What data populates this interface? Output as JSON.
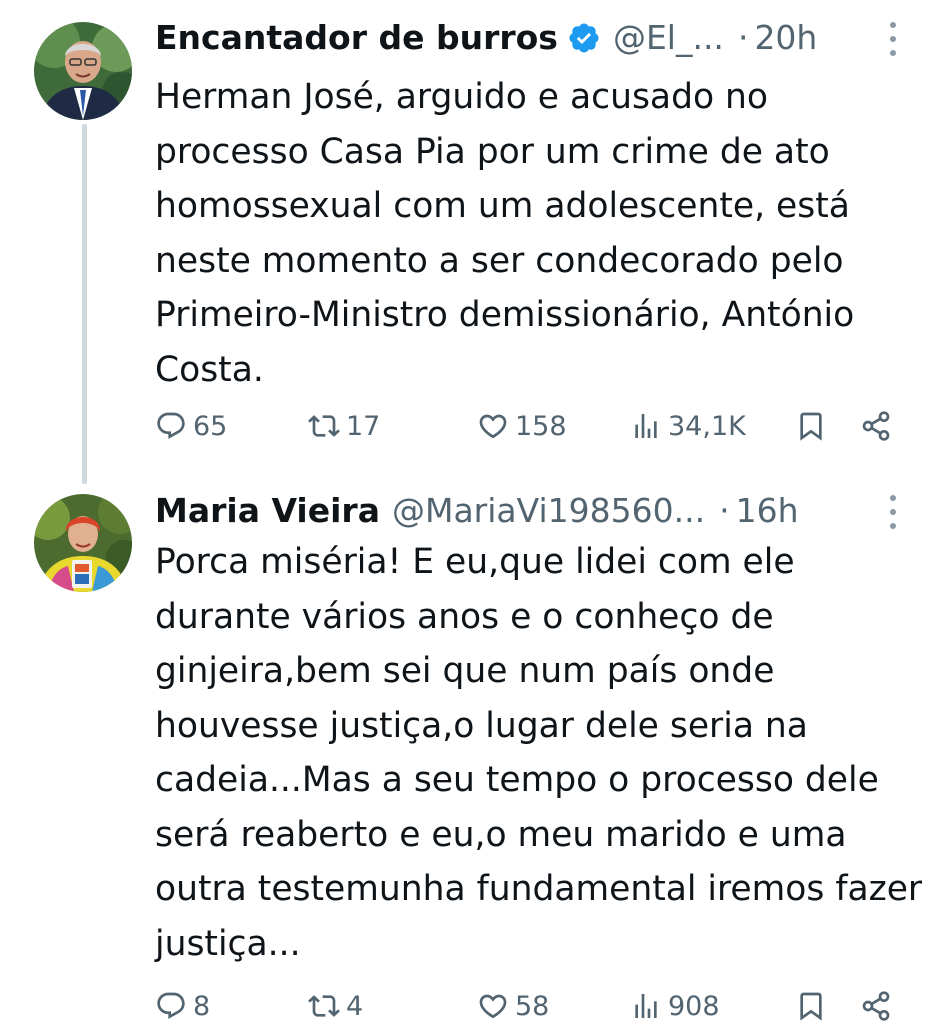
{
  "tweets": [
    {
      "author_name": "Encantador de burros",
      "verified": true,
      "handle": "@El_...",
      "separator": "·",
      "time": "20h",
      "text": "Herman José, arguido e acusado no processo Casa Pia por um crime de ato homossexual com um adolescente, está neste momento a ser condecorado pelo Primeiro-Ministro demissionário, António Costa.",
      "replies": "65",
      "retweets": "17",
      "likes": "158",
      "views": "34,1K"
    },
    {
      "author_name": "Maria Vieira",
      "verified": false,
      "handle": "@MariaVi198560...",
      "separator": "·",
      "time": "16h",
      "text": "Porca miséria! E eu,que lidei com ele durante vários anos e o conheço de ginjeira,bem sei que num país onde houvesse justiça,o lugar dele seria na cadeia...Mas a seu tempo o processo dele será reaberto e eu,o meu marido e uma outra testemunha fundamental iremos fazer justiça...",
      "replies": "8",
      "retweets": "4",
      "likes": "58",
      "views": "908"
    }
  ],
  "colors": {
    "text": "#0f1419",
    "secondary": "#536471",
    "verified_blue": "#1d9bf0",
    "thread_line": "#cfd9de"
  },
  "icons": [
    "reply-icon",
    "retweet-icon",
    "like-icon",
    "views-icon",
    "bookmark-icon",
    "share-icon",
    "more-icon",
    "verified-badge-icon"
  ]
}
